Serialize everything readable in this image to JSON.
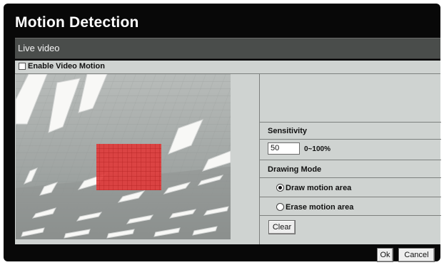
{
  "dialog": {
    "title": "Motion Detection",
    "section_header": "Live video",
    "enable_label": "Enable Video Motion",
    "enable_checked": false
  },
  "controls": {
    "sensitivity_label": "Sensitivity",
    "sensitivity_value": "50",
    "sensitivity_range": "0~100%",
    "drawing_mode_label": "Drawing Mode",
    "draw_option": "Draw motion area",
    "erase_option": "Erase motion area",
    "selected_mode": "draw",
    "clear_label": "Clear"
  },
  "footer": {
    "ok_label": "Ok",
    "cancel_label": "Cancel"
  },
  "colors": {
    "motion_area": "#e03b3b",
    "panel": "#cfd3d1",
    "header": "#4a4d4b"
  }
}
